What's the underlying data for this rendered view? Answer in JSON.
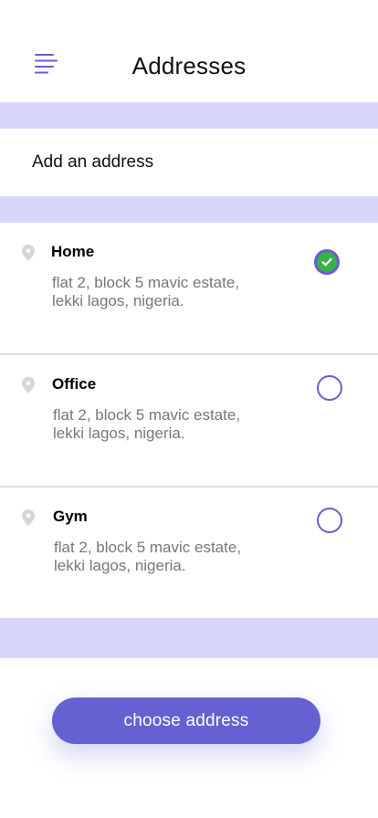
{
  "header": {
    "title": "Addresses",
    "menu_icon": "hamburger-menu-icon"
  },
  "add_address": {
    "label": "Add an address"
  },
  "addresses": [
    {
      "name": "Home",
      "line1": "flat 2, block 5 mavic estate,",
      "line2": "lekki lagos, nigeria.",
      "selected": true
    },
    {
      "name": "Office",
      "line1": "flat 2, block 5 mavic estate,",
      "line2": "lekki lagos, nigeria.",
      "selected": false
    },
    {
      "name": "Gym",
      "line1": "flat 2, block 5 mavic estate,",
      "line2": "lekki lagos, nigeria.",
      "selected": false
    }
  ],
  "footer": {
    "button_label": "choose address"
  },
  "colors": {
    "accent": "#6561d3",
    "band": "#d8d7fb",
    "selected_fill": "#36b24a",
    "secondary_text": "#777777"
  }
}
